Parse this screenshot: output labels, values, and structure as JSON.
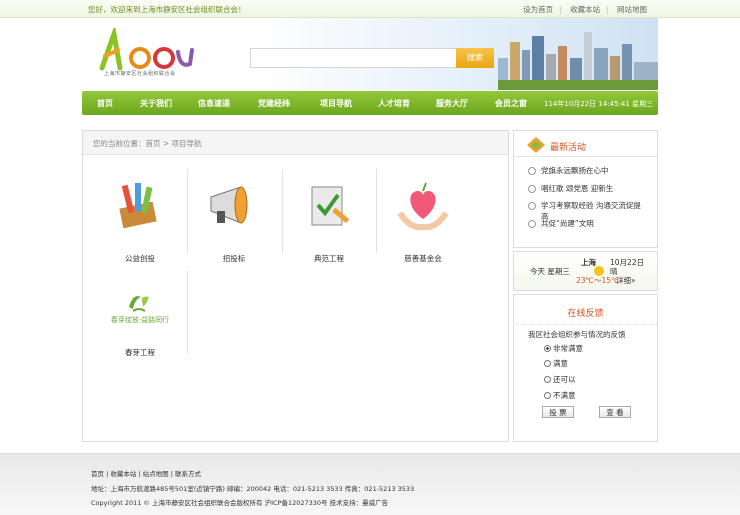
{
  "topbar": {
    "welcome": "您好，欢迎来到上海市静安区社会组织联合会！",
    "links": [
      "设为首页",
      "收藏本站",
      "网站地图"
    ]
  },
  "header": {
    "logo_sub": "上海市静安区社会组织联合会",
    "search_placeholder": "",
    "search_button": "搜索"
  },
  "nav": {
    "items": [
      "首页",
      "关于我们",
      "信息速递",
      "党建经纬",
      "项目导航",
      "人才培育",
      "服务大厅",
      "会员之窗"
    ],
    "datetime": "114年10月22日 14:45:41 星期三"
  },
  "breadcrumb": "您的当前位置：首页 > 项目导航",
  "projects": [
    "公益创投",
    "招投标",
    "典范工程",
    "慈善基金会",
    "春芽工程"
  ],
  "project_logo_text": "春芽绽放·益路同行",
  "news": {
    "title": "最新活动",
    "items": [
      "党旗永远飘扬在心中",
      "唱红歌 颂党恩 迎新生",
      "学习考察取经验 沟通交流促提高",
      "共促“尚建”文明"
    ]
  },
  "weather": {
    "today": "今天  星期三",
    "city": "上海",
    "date": "10月22日",
    "condition": "晴",
    "temp": "23℃～15℃",
    "detail": "详细»"
  },
  "feedback": {
    "title": "在线反馈",
    "question": "我区社会组织参与情况的反馈",
    "options": [
      "非常满意",
      "满意",
      "还可以",
      "不满意"
    ],
    "selected_index": 0,
    "vote_button": "投 票",
    "view_button": "查 看"
  },
  "footer": {
    "links": "首页 | 收藏本站 | 站点地图 | 联系方式",
    "address": "地址：上海市万航渡路485号501室(近镇宁路)  邮编：200042  电话：021-5213 3533  传真：021-5213 3533",
    "copyright": "Copyright 2011 © 上海市静安区社会组织联合会版权所有  沪ICP备12027330号  技术支持：曼威广告"
  },
  "colors": {
    "accent_green": "#7cb526",
    "accent_orange": "#d9531e",
    "search_yellow": "#f0b428"
  }
}
